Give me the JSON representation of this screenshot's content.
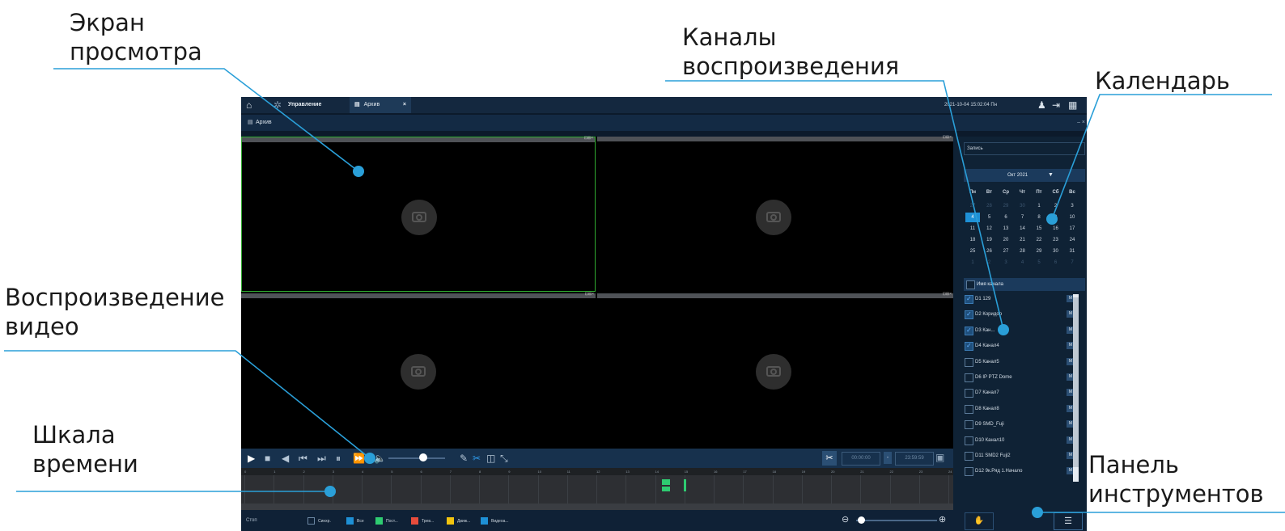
{
  "callouts": {
    "screen": [
      "Экран",
      "просмотра"
    ],
    "channels": [
      "Каналы",
      "воспроизведения"
    ],
    "calendar": "Календарь",
    "playback": [
      "Воспроизведение",
      "видео"
    ],
    "timeline": [
      "Шкала",
      "времени"
    ],
    "toolbar": [
      "Панель",
      "инструментов"
    ]
  },
  "app": {
    "tabs": {
      "manage": "Управление",
      "archive": "Архив",
      "close": "×"
    },
    "datetime": "2021-10-04 15:02:04 Пн",
    "subtitle": "Архив",
    "sub_controls": "– ×",
    "pane_tools": "⊡⊞×",
    "time_from": "00:00:00",
    "time_sep": "-",
    "time_to": "23:59:59",
    "hours": [
      "0",
      "1",
      "2",
      "3",
      "4",
      "5",
      "6",
      "7",
      "8",
      "9",
      "10",
      "11",
      "12",
      "13",
      "14",
      "15",
      "16",
      "17",
      "18",
      "19",
      "20",
      "21",
      "22",
      "23",
      "24"
    ],
    "status": "Стоп",
    "legend": [
      "Синхр.",
      "Все",
      "Пост...",
      "Трев...",
      "Движ...",
      "Видеоа..."
    ],
    "colors": {
      "accent": "#1e90d6",
      "selected_pane": "#2faa2f",
      "rec_green": "#2ecc71"
    }
  },
  "side": {
    "record_type": "Запись",
    "month": "Окт 2021",
    "weekdays": [
      "Пн",
      "Вт",
      "Ср",
      "Чт",
      "Пт",
      "Сб",
      "Вс"
    ],
    "days": [
      [
        "27",
        "28",
        "29",
        "30",
        "1",
        "2",
        "3"
      ],
      [
        "4",
        "5",
        "6",
        "7",
        "8",
        "9",
        "10"
      ],
      [
        "11",
        "12",
        "13",
        "14",
        "15",
        "16",
        "17"
      ],
      [
        "18",
        "19",
        "20",
        "21",
        "22",
        "23",
        "24"
      ],
      [
        "25",
        "26",
        "27",
        "28",
        "29",
        "30",
        "31"
      ],
      [
        "1",
        "2",
        "3",
        "4",
        "5",
        "6",
        "7"
      ]
    ],
    "channel_header": "Имя канала",
    "channels": [
      {
        "name": "D1 129",
        "checked": true
      },
      {
        "name": "D2 Коридор",
        "checked": true
      },
      {
        "name": "D3 Кан...",
        "checked": true
      },
      {
        "name": "D4 Канал4",
        "checked": true
      },
      {
        "name": "D5 Канал5",
        "checked": false
      },
      {
        "name": "D6 IP PTZ Dome",
        "checked": false
      },
      {
        "name": "D7 Канал7",
        "checked": false
      },
      {
        "name": "D8 Канал8",
        "checked": false
      },
      {
        "name": "D9 SMD_Fuji",
        "checked": false
      },
      {
        "name": "D10 Канал10",
        "checked": false
      },
      {
        "name": "D11 SMD2 Fuji2",
        "checked": false
      },
      {
        "name": "D12 9к.Ряд 1.Начало",
        "checked": false
      }
    ],
    "m_label": "M"
  }
}
